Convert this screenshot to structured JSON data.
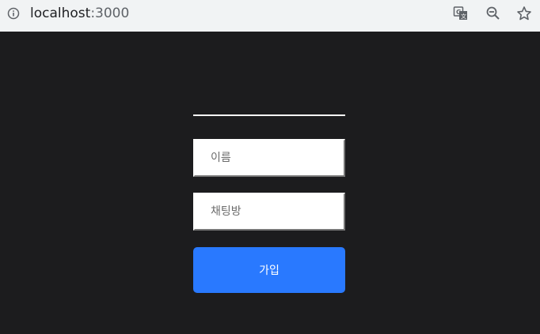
{
  "browser": {
    "url_host": "localhost",
    "url_port": ":3000",
    "icons": [
      "info-icon",
      "translate-icon",
      "zoom-out-icon",
      "star-icon"
    ]
  },
  "form": {
    "name_placeholder": "이름",
    "room_placeholder": "채팅방",
    "join_label": "가입"
  },
  "colors": {
    "background": "#1c1c1e",
    "accent": "#2979ff"
  }
}
